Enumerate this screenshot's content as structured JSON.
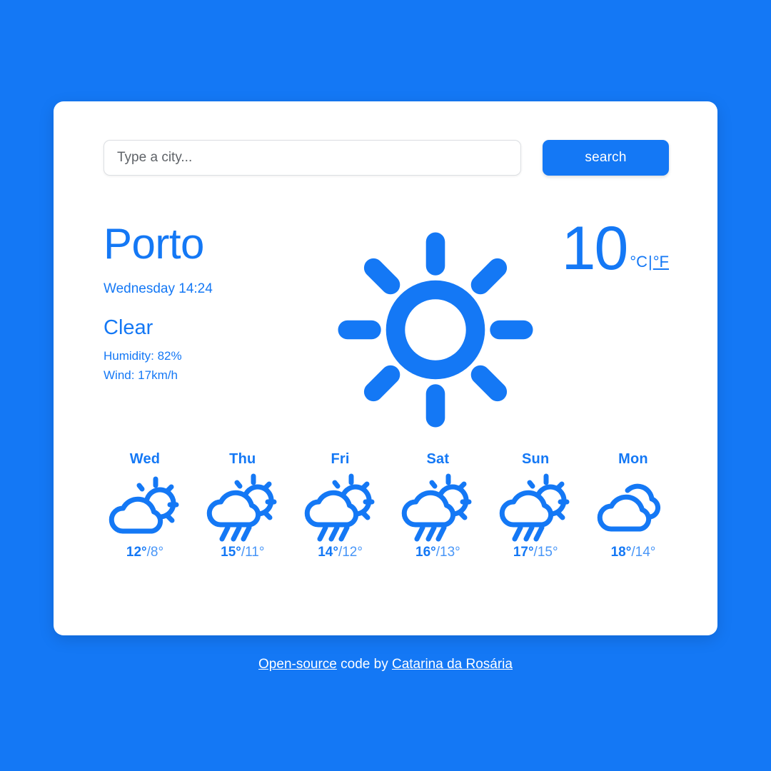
{
  "theme": {
    "background": "#1478f5",
    "card_background": "#ffffff",
    "accent": "#1478f5",
    "footer_text": "#ffffff"
  },
  "search": {
    "placeholder": "Type a city...",
    "value": "",
    "button_label": "search"
  },
  "current": {
    "city": "Porto",
    "datetime": "Wednesday 14:24",
    "condition": "Clear",
    "humidity": "Humidity: 82%",
    "wind": "Wind: 17km/h",
    "temperature": "10",
    "unit_celsius": "°C",
    "unit_separator": "|",
    "unit_fahrenheit": "°F",
    "icon": "sun-icon"
  },
  "forecast": {
    "days": [
      {
        "label": "Wed",
        "icon": "partly-cloudy-day-icon",
        "max": "12°",
        "sep": "/",
        "min": "8°"
      },
      {
        "label": "Thu",
        "icon": "rain-sun-icon",
        "max": "15°",
        "sep": "/",
        "min": "11°"
      },
      {
        "label": "Fri",
        "icon": "rain-sun-icon",
        "max": "14°",
        "sep": "/",
        "min": "12°"
      },
      {
        "label": "Sat",
        "icon": "rain-sun-icon",
        "max": "16°",
        "sep": "/",
        "min": "13°"
      },
      {
        "label": "Sun",
        "icon": "rain-sun-icon",
        "max": "17°",
        "sep": "/",
        "min": "15°"
      },
      {
        "label": "Mon",
        "icon": "cloudy-icon",
        "max": "18°",
        "sep": "/",
        "min": "14°"
      }
    ]
  },
  "footer": {
    "link_open_source": "Open-source",
    "middle_text": " code by ",
    "link_author": "Catarina da Rosária"
  }
}
